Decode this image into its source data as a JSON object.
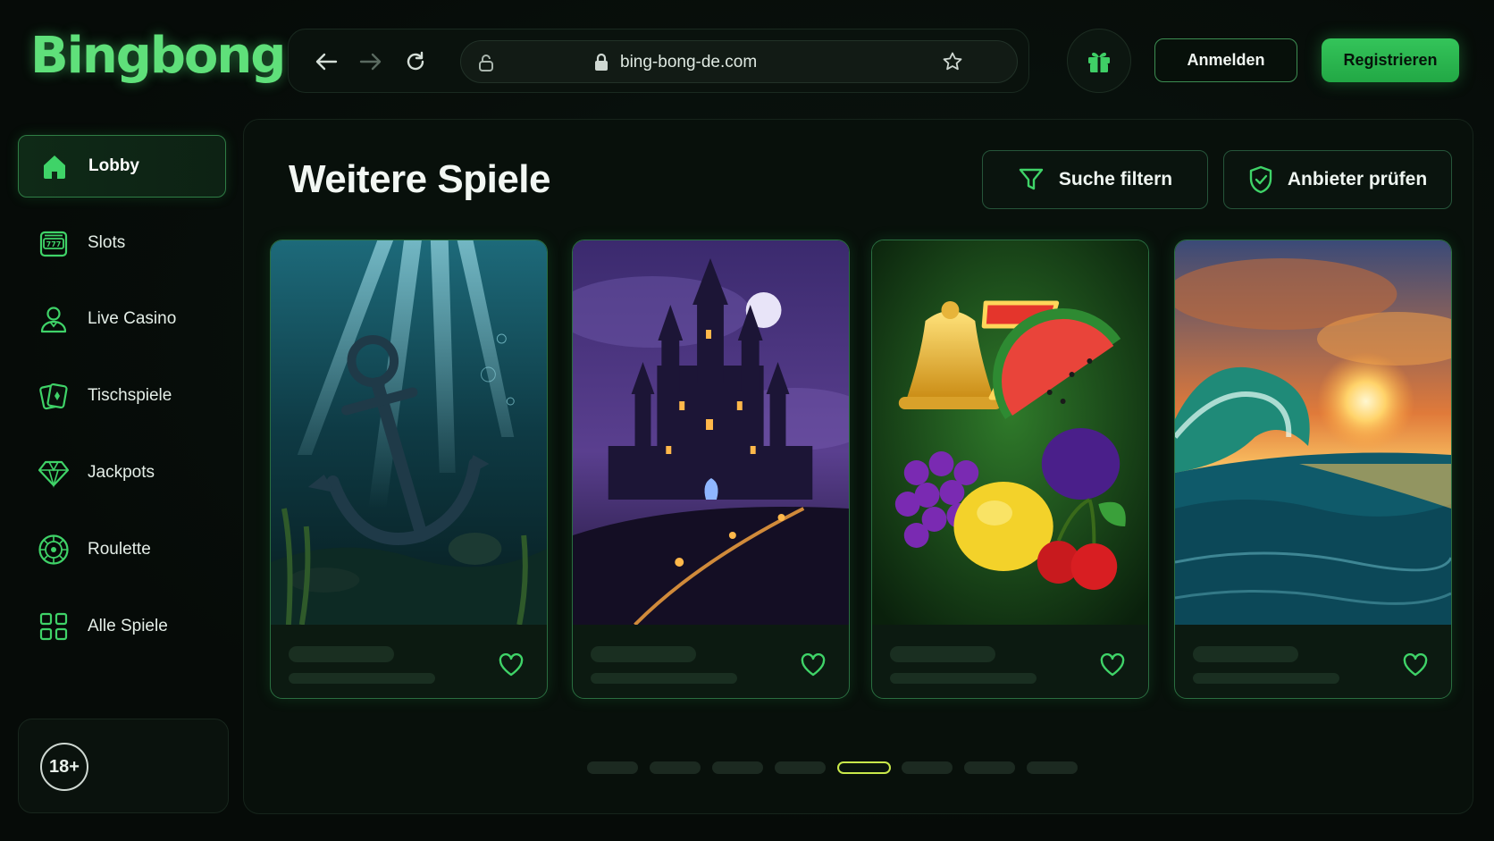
{
  "brand": {
    "name": "Bingbong",
    "accent": "#5fe07a"
  },
  "browser": {
    "url": "bing-bong-de.com"
  },
  "header": {
    "login_label": "Anmelden",
    "register_label": "Registrieren"
  },
  "sidebar": {
    "items": [
      {
        "label": "Lobby",
        "icon": "home-icon",
        "active": true
      },
      {
        "label": "Slots",
        "icon": "slot-machine-icon"
      },
      {
        "label": "Live Casino",
        "icon": "dealer-icon"
      },
      {
        "label": "Tischspiele",
        "icon": "cards-icon"
      },
      {
        "label": "Jackpots",
        "icon": "diamond-icon"
      },
      {
        "label": "Roulette",
        "icon": "roulette-icon"
      },
      {
        "label": "Alle Spiele",
        "icon": "grid-icon"
      }
    ],
    "age_label": "18+"
  },
  "main": {
    "title": "Weitere Spiele",
    "filter_label": "Suche filtern",
    "provider_label": "Anbieter prüfen",
    "games": [
      {
        "art": "underwater-anchor"
      },
      {
        "art": "night-castle"
      },
      {
        "art": "fruit-slots"
      },
      {
        "art": "ocean-sunset-wave"
      }
    ],
    "pagination": {
      "pages": 8,
      "current": 5
    }
  }
}
